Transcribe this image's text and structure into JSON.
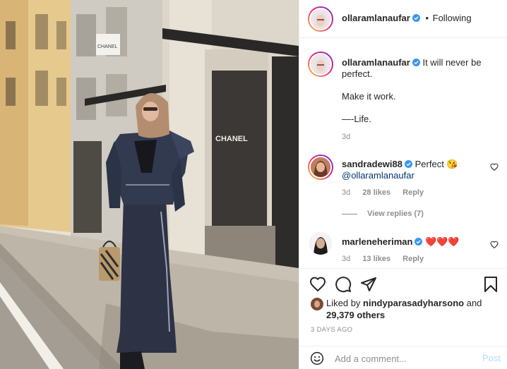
{
  "post": {
    "author": "ollaramlanaufar",
    "separator": "•",
    "follow_status": "Following",
    "caption_lines": [
      "It will never be perfect.",
      "Make it work.",
      "—-Life."
    ],
    "caption_age": "3d"
  },
  "photo": {
    "store_sign": "CHANEL",
    "store_sign_small": "CHANEL"
  },
  "comments": [
    {
      "username": "sandradewi88",
      "text": "Perfect 😘",
      "mention": "@ollaramlanaufar",
      "age": "3d",
      "likes": "28 likes",
      "reply_label": "Reply",
      "view_replies": "View replies (7)"
    },
    {
      "username": "marleneheriman",
      "text": "❤️❤️❤️",
      "age": "3d",
      "likes": "13 likes",
      "reply_label": "Reply"
    }
  ],
  "engagement": {
    "liked_by_prefix": "Liked by",
    "liked_by_user": "nindyparasadyharsono",
    "liked_by_and": "and",
    "others_count": "29,379 others",
    "posted_ago": "3 DAYS AGO"
  },
  "comment_box": {
    "placeholder": "Add a comment...",
    "post_label": "Post"
  },
  "colors": {
    "verified": "#3897f0",
    "link": "#00376b",
    "muted": "#8e8e8e",
    "post_button_disabled": "#b2dffc",
    "heart_red": "#ed4956"
  },
  "icons": [
    "heart-icon",
    "comment-icon",
    "share-icon",
    "bookmark-icon",
    "emoji-icon",
    "verified-icon"
  ]
}
